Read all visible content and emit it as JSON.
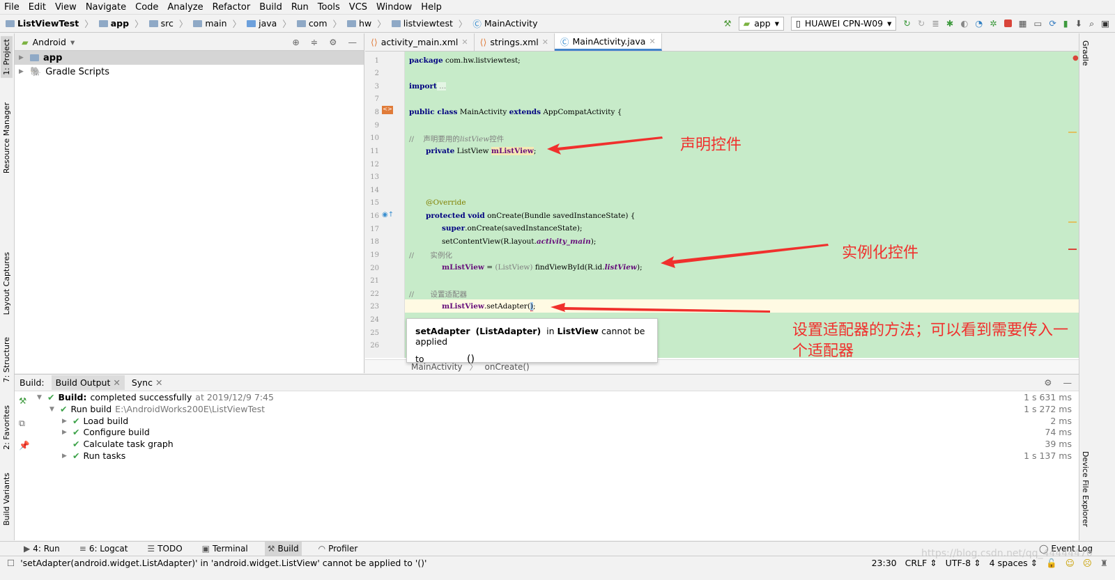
{
  "menu": [
    "File",
    "Edit",
    "View",
    "Navigate",
    "Code",
    "Analyze",
    "Refactor",
    "Build",
    "Run",
    "Tools",
    "VCS",
    "Window",
    "Help"
  ],
  "breadcrumb": [
    "ListViewTest",
    "app",
    "src",
    "main",
    "java",
    "com",
    "hw",
    "listviewtest",
    "MainActivity"
  ],
  "toolbar": {
    "config": "app",
    "device": "HUAWEI CPN-W09"
  },
  "left_strip": [
    "1: Project",
    "Resource Manager",
    "Layout Captures",
    "7: Structure",
    "2: Favorites",
    "Build Variants"
  ],
  "right_strip": [
    "Gradle",
    "Device File Explorer"
  ],
  "project": {
    "view": "Android",
    "items": [
      {
        "label": "app",
        "selected": true
      },
      {
        "label": "Gradle Scripts",
        "selected": false
      }
    ]
  },
  "editor": {
    "tabs": [
      {
        "label": "activity_main.xml",
        "active": false
      },
      {
        "label": "strings.xml",
        "active": false
      },
      {
        "label": "MainActivity.java",
        "active": true
      }
    ],
    "line_numbers": [
      "1",
      "2",
      "3",
      "7",
      "8",
      "9",
      "10",
      "11",
      "12",
      "13",
      "14",
      "15",
      "16",
      "17",
      "18",
      "19",
      "20",
      "21",
      "22",
      "23",
      "24",
      "25",
      "26"
    ],
    "code": {
      "l1a": "package",
      "l1b": " com.hw.listviewtest;",
      "l3a": "import",
      "l3b": " ...",
      "l8a": "public class",
      "l8b": " MainActivity ",
      "l8c": "extends",
      "l8d": " AppCompatActivity {",
      "l10a": "//    声明要用的",
      "l10b": "listView",
      "l10c": "控件",
      "l11a": "private",
      "l11b": " ListView ",
      "l11c": "mListView",
      "l11d": ";",
      "l15": "@Override",
      "l16a": "protected void",
      "l16b": " onCreate(Bundle savedInstanceState) {",
      "l17a": "super",
      "l17b": ".onCreate(savedInstanceState);",
      "l18a": "setContentView(R.layout.",
      "l18b": "activity_main",
      "l18c": ");",
      "l19": "//       实例化",
      "l20a": "mListView",
      "l20b": " = ",
      "l20c": "(ListView)",
      "l20d": " findViewById(R.id.",
      "l20e": "listView",
      "l20f": ");",
      "l22": "//       设置适配器",
      "l23a": "mListView",
      "l23b": ".setAdapter(",
      "l23c": ")",
      "l23d": ";"
    },
    "tooltip": {
      "method": "setAdapter",
      "params": "(ListAdapter)",
      "in": "in",
      "cls": "ListView",
      "msg": "cannot be applied",
      "to": "to",
      "arg": "()"
    },
    "crumbs": [
      "MainActivity",
      "onCreate()"
    ]
  },
  "annotations": {
    "a1": "声明控件",
    "a2": "实例化控件",
    "a3_line1": "设置适配器的方法；可以看到需要传入一",
    "a3_line2": "个适配器",
    "color": "#f0302d"
  },
  "build": {
    "label": "Build:",
    "tabs": [
      "Build Output",
      "Sync"
    ],
    "rows": [
      {
        "bold": "Build:",
        "text": " completed successfully",
        "extra": " at 2019/12/9 7:45",
        "time": "1 s 631 ms"
      },
      {
        "text": "Run build",
        "extra": " E:\\AndroidWorks200E\\ListViewTest",
        "time": "1 s 272 ms"
      },
      {
        "text": "Load build",
        "time": "2 ms"
      },
      {
        "text": "Configure build",
        "time": "74 ms"
      },
      {
        "text": "Calculate task graph",
        "time": "39 ms"
      },
      {
        "text": "Run tasks",
        "time": "1 s 137 ms"
      }
    ]
  },
  "bottom_tabs": [
    "4: Run",
    "6: Logcat",
    "TODO",
    "Terminal",
    "Build",
    "Profiler"
  ],
  "event_log": "Event Log",
  "status": {
    "message": "'setAdapter(android.widget.ListAdapter)' in 'android.widget.ListView' cannot be applied to '()'",
    "position": "23:30",
    "line_sep": "CRLF",
    "encoding": "UTF-8",
    "indent": "4 spaces"
  },
  "watermark": "https://blog.csdn.net/qq_44444470"
}
